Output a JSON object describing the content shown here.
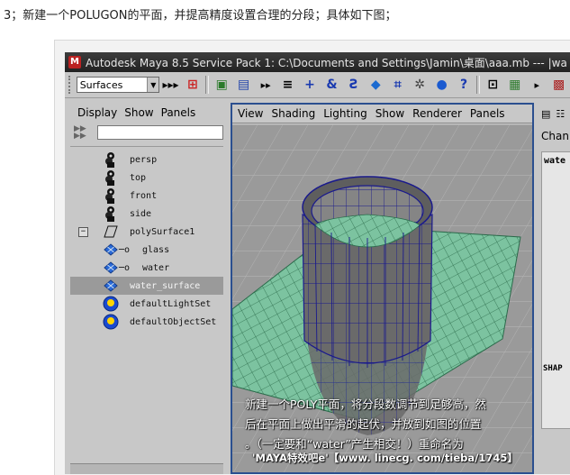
{
  "caption": "3；新建一个POLUGON的平面，并提高精度设置合理的分段；具体如下图；",
  "window": {
    "title": "Autodesk Maya 8.5 Service Pack 1: C:\\Documents and Settings\\Jamin\\桌面\\aaa.mb   ---   |wa"
  },
  "toolbar": {
    "menu_set": "Surfaces",
    "icons": [
      "snap-grid-icon",
      "snap-curve-icon",
      "snap-point-icon",
      "snap-surface-icon",
      "history-icon",
      "render-icon",
      "ipr-icon",
      "move-icon",
      "rotate-icon",
      "scale-icon",
      "lattice-icon",
      "sphere-icon",
      "help-icon",
      "lock-icon",
      "input-line-icon",
      "tool-settings-icon"
    ]
  },
  "outliner": {
    "menu": [
      "Display",
      "Show",
      "Panels"
    ],
    "items": [
      {
        "label": "persp",
        "icon": "camera-icon",
        "indent": 0
      },
      {
        "label": "top",
        "icon": "camera-icon",
        "indent": 0
      },
      {
        "label": "front",
        "icon": "camera-icon",
        "indent": 0
      },
      {
        "label": "side",
        "icon": "camera-icon",
        "indent": 0
      },
      {
        "label": "polySurface1",
        "icon": "transform-icon",
        "indent": 0
      },
      {
        "label": "glass",
        "icon": "mesh-icon",
        "indent": 1
      },
      {
        "label": "water",
        "icon": "mesh-icon",
        "indent": 1
      },
      {
        "label": "water_surface",
        "icon": "mesh-icon",
        "indent": 0
      },
      {
        "label": "defaultLightSet",
        "icon": "set-icon",
        "indent": 0
      },
      {
        "label": "defaultObjectSet",
        "icon": "set-icon",
        "indent": 0
      }
    ],
    "selected_item": "water_surface"
  },
  "viewport": {
    "menu": [
      "View",
      "Shading",
      "Lighting",
      "Show",
      "Renderer",
      "Panels"
    ],
    "overlay_lines": [
      "新建一个POLY平面，将分段数调节到足够高，然",
      "后在平面上做出平滑的起伏，并放到如图的位置",
      "。（一定要和“water”产生相交！）重命名为"
    ],
    "watermark": "'MAYA特效吧e'【www. linecg. com/tieba/1745】"
  },
  "channel_box": {
    "tab": "Chan",
    "object_name": "wate",
    "shapes_label": "SHAP"
  },
  "colors": {
    "viewport_bg": "#9a9a9a",
    "wireframe": "#1a1a8c",
    "plane": "#7cc3a0",
    "selected_border": "#2b4f8f"
  }
}
